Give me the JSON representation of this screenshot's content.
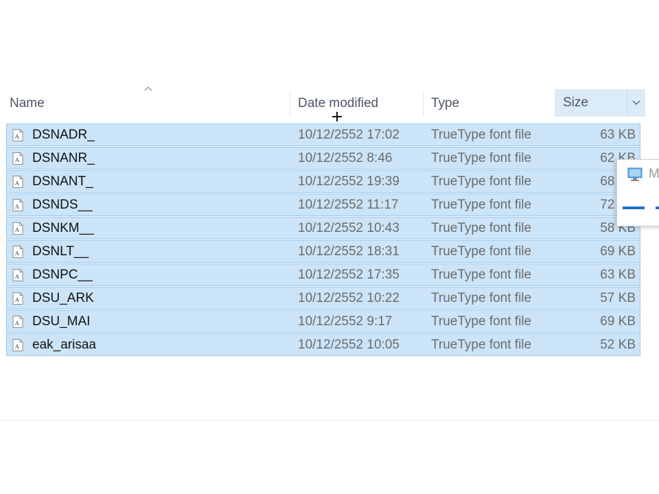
{
  "header": {
    "name": "Name",
    "date_modified": "Date modified",
    "type": "Type",
    "size": "Size"
  },
  "sort": {
    "column": "Name",
    "direction": "ascending"
  },
  "files": [
    {
      "name": "DSNADR_",
      "date": "10/12/2552 17:02",
      "type": "TrueType font file",
      "size": "63 KB"
    },
    {
      "name": "DSNANR_",
      "date": "10/12/2552 8:46",
      "type": "TrueType font file",
      "size": "62 KB"
    },
    {
      "name": "DSNANT_",
      "date": "10/12/2552 19:39",
      "type": "TrueType font file",
      "size": "68 KB"
    },
    {
      "name": "DSNDS__",
      "date": "10/12/2552 11:17",
      "type": "TrueType font file",
      "size": "72 KB"
    },
    {
      "name": "DSNKM__",
      "date": "10/12/2552 10:43",
      "type": "TrueType font file",
      "size": "58 KB"
    },
    {
      "name": "DSNLT__",
      "date": "10/12/2552 18:31",
      "type": "TrueType font file",
      "size": "69 KB"
    },
    {
      "name": "DSNPC__",
      "date": "10/12/2552 17:35",
      "type": "TrueType font file",
      "size": "63 KB"
    },
    {
      "name": "DSU_ARK",
      "date": "10/12/2552 10:22",
      "type": "TrueType font file",
      "size": "57 KB"
    },
    {
      "name": "DSU_MAI",
      "date": "10/12/2552 9:17",
      "type": "TrueType font file",
      "size": "69 KB"
    },
    {
      "name": "eak_arisaa",
      "date": "10/12/2552 10:05",
      "type": "TrueType font file",
      "size": "52 KB"
    }
  ],
  "popup": {
    "label": "M"
  },
  "icons": {
    "file": "font-file-icon",
    "sort": "sort-up-arrow-icon",
    "dropdown": "chevron-down-icon",
    "cursor": "move-cursor-icon",
    "popup": "monitor-icon"
  },
  "colors": {
    "selection_bg": "#cce4f7",
    "selection_border": "#99c9ef",
    "header_text": "#4a5563",
    "secondary_text": "#6b6b6b",
    "accent": "#1f6fd1"
  }
}
